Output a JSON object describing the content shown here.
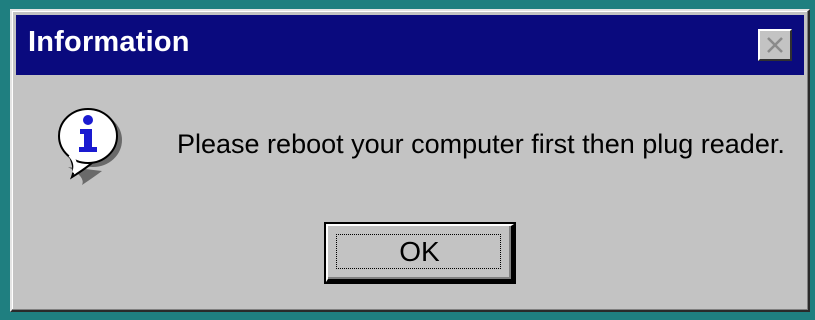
{
  "dialog": {
    "title": "Information",
    "message": "Please reboot your computer first then plug reader.",
    "ok_label": "OK",
    "icon": "info-icon",
    "close_icon": "close-icon"
  },
  "colors": {
    "desktop": "#1f7f80",
    "titlebar": "#0a0a7e",
    "dialog_face": "#c3c3c3",
    "icon_blue": "#1a1ad0"
  }
}
